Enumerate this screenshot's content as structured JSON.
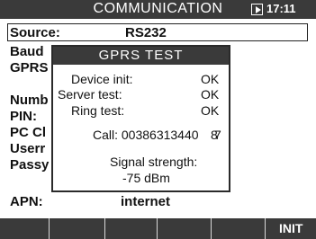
{
  "header": {
    "title": "COMMUNICATION",
    "time": "17:11"
  },
  "settings": {
    "source": {
      "label": "Source:",
      "value": "RS232"
    },
    "rows_left": [
      "Baud",
      "GPRS",
      "Numb",
      "PIN:",
      "PC Cl",
      "Userr",
      "Passy"
    ],
    "apn": {
      "label": "APN:",
      "value": "internet"
    }
  },
  "dialog": {
    "title": "GPRS TEST",
    "device_init_label": "Device init:",
    "device_init_value": "OK",
    "server_test_label": "Server test:",
    "server_test_value": "OK",
    "ring_test_label": "Ring test:",
    "ring_test_value": "OK",
    "call_text": "Call: 00386313440",
    "call_overlap_a": "8",
    "call_overlap_b": "7",
    "signal_label": "Signal strength:",
    "signal_value": "-75 dBm"
  },
  "softkeys": [
    "",
    "",
    "",
    "",
    "INIT"
  ]
}
